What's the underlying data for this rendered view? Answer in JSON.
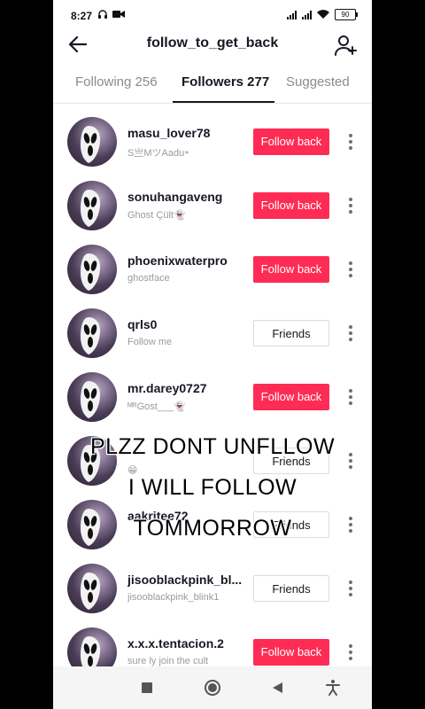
{
  "status_bar": {
    "time": "8:27",
    "battery": "90"
  },
  "header": {
    "title": "follow_to_get_back",
    "back_icon": "arrow-left-icon",
    "add_icon": "add-user-icon"
  },
  "tabs": [
    {
      "label": "Following 256",
      "active": false
    },
    {
      "label": "Followers 277",
      "active": true
    },
    {
      "label": "Suggested",
      "active": false
    }
  ],
  "users": [
    {
      "username": "masu_lover78",
      "subtitle": "S亗MツAadu⁍",
      "button": "Follow back",
      "type": "follow"
    },
    {
      "username": "sonuhangaveng",
      "subtitle": "Ghost Çült👻",
      "button": "Follow back",
      "type": "follow"
    },
    {
      "username": "phoenixwaterpro",
      "subtitle": "ghostface",
      "button": "Follow back",
      "type": "follow"
    },
    {
      "username": "qrls0",
      "subtitle": "Follow me",
      "button": "Friends",
      "type": "friends"
    },
    {
      "username": "mr.darey0727",
      "subtitle": "ᴹᴿGost___👻",
      "button": "Follow back",
      "type": "follow"
    },
    {
      "username": "",
      "subtitle": "😁",
      "button": "Friends",
      "type": "friends"
    },
    {
      "username": "aakritee72",
      "subtitle": "",
      "button": "Friends",
      "type": "friends"
    },
    {
      "username": "jisooblackpink_bl...",
      "subtitle": "jisooblackpink_blink1",
      "button": "Friends",
      "type": "friends"
    },
    {
      "username": "x.x.x.tentacion.2",
      "subtitle": "sure ly join the cult",
      "button": "Follow back",
      "type": "follow"
    }
  ],
  "overlay_caption": {
    "line1": "PLZZ DONT UNFLLOW",
    "line2": "I WILL FOLLOW",
    "line3": "TOMMORROW"
  },
  "nav_bar": {
    "icons": [
      "recent-apps-icon",
      "home-icon",
      "back-triangle-icon",
      "accessibility-icon"
    ]
  },
  "colors": {
    "follow_button": "#fe2c55",
    "text_primary": "#161823",
    "text_secondary": "#9a9aa0"
  }
}
